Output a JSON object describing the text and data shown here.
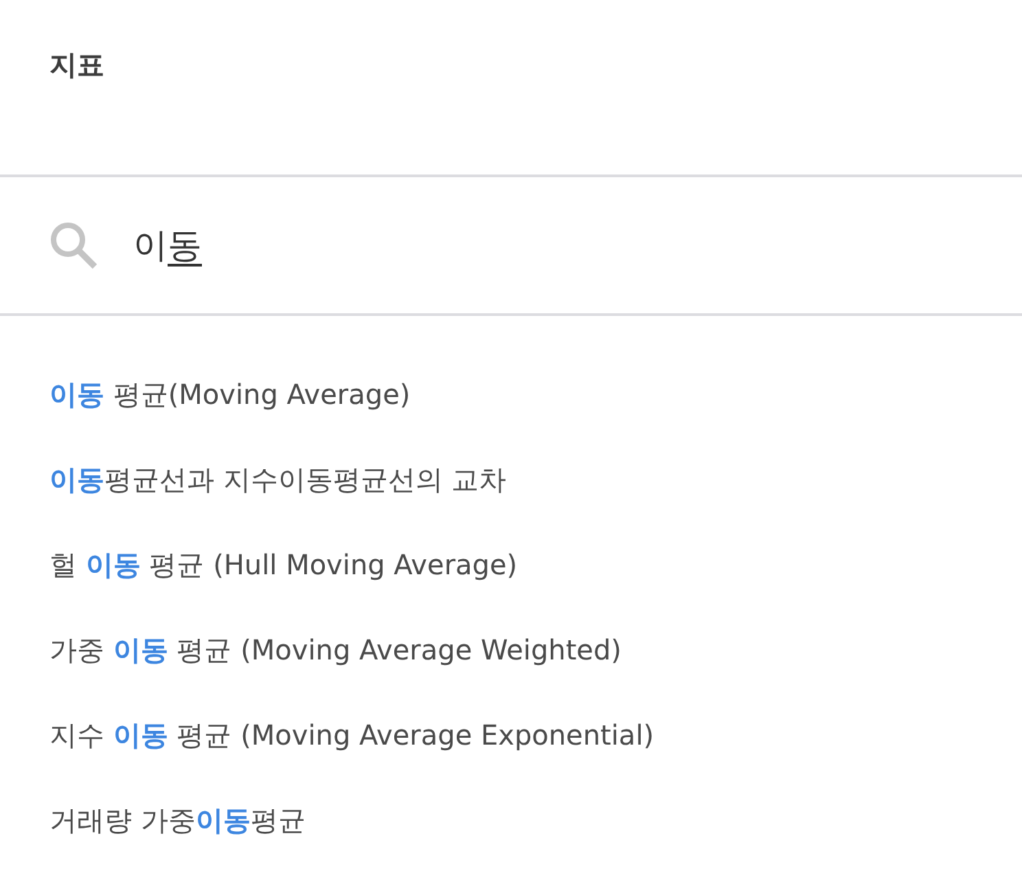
{
  "panel": {
    "title": "지표"
  },
  "search": {
    "value": "이",
    "composing": "동"
  },
  "results": [
    {
      "label": "**이동** 평균(Moving Average)"
    },
    {
      "label": "**이동**평균선과 지수이동평균선의 교차"
    },
    {
      "label": "헐 **이동** 평균 (Hull Moving Average)"
    },
    {
      "label": "가중 **이동** 평균 (Moving Average Weighted)"
    },
    {
      "label": "지수 **이동** 평균 (Moving Average Exponential)"
    },
    {
      "label": "거래량 가중**이동**평균"
    }
  ]
}
